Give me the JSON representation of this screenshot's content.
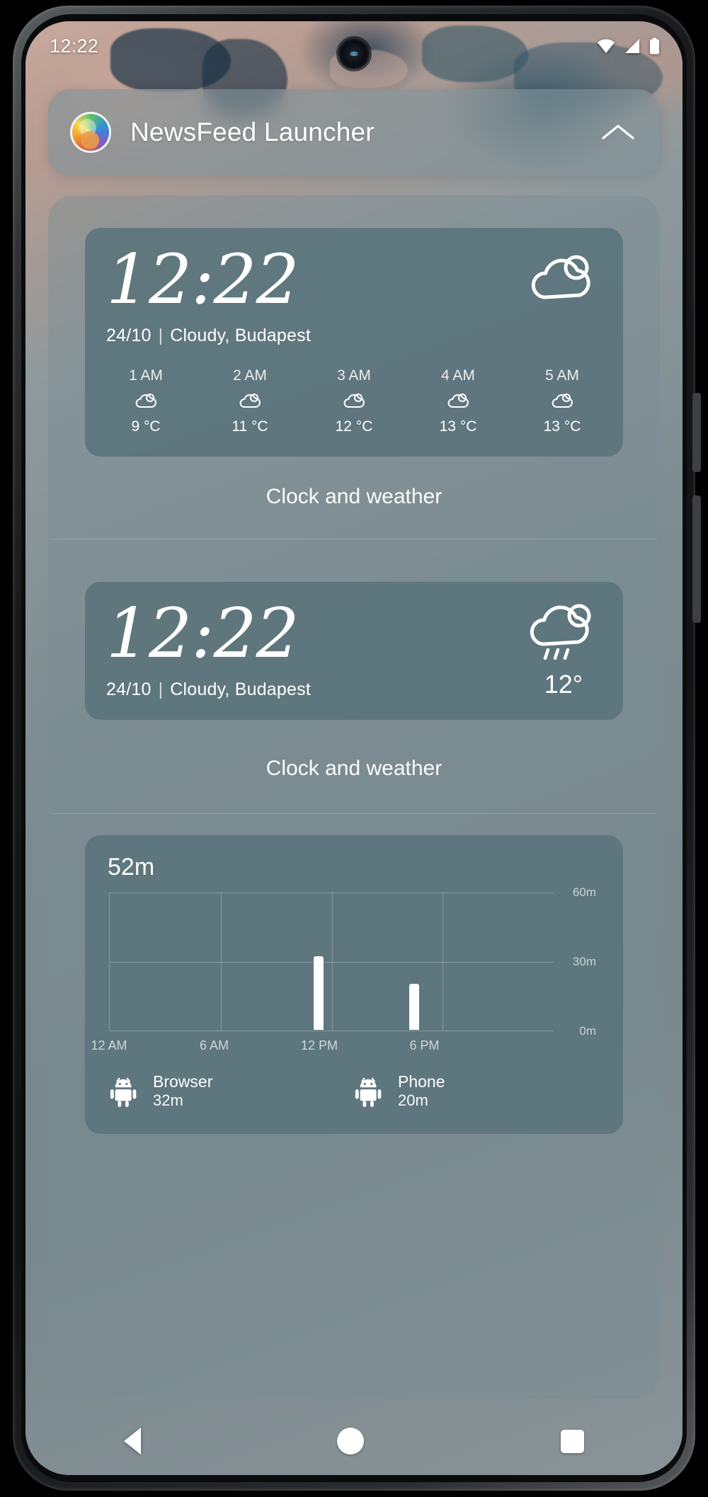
{
  "status_bar": {
    "clock": "12:22",
    "icons": [
      "wifi-icon",
      "signal-icon",
      "battery-icon"
    ]
  },
  "header": {
    "app_icon": "newsfeed-launcher-logo",
    "title": "NewsFeed Launcher",
    "collapse_icon": "chevron-up-icon"
  },
  "widgets": [
    {
      "type": "clock-weather-large",
      "clock": "12:22",
      "date": "24/10",
      "separator": "|",
      "condition_location": "Cloudy, Budapest",
      "weather_icon": "partly-cloudy-icon",
      "label": "Clock and weather",
      "forecast": [
        {
          "hour": "1 AM",
          "icon": "partly-cloudy-icon",
          "temp": "9 °C"
        },
        {
          "hour": "2 AM",
          "icon": "partly-cloudy-icon",
          "temp": "11 °C"
        },
        {
          "hour": "3 AM",
          "icon": "partly-cloudy-icon",
          "temp": "12 °C"
        },
        {
          "hour": "4 AM",
          "icon": "partly-cloudy-icon",
          "temp": "13 °C"
        },
        {
          "hour": "5 AM",
          "icon": "partly-cloudy-icon",
          "temp": "13 °C"
        }
      ]
    },
    {
      "type": "clock-weather-compact",
      "clock": "12:22",
      "date": "24/10",
      "separator": "|",
      "condition_location": "Cloudy, Budapest",
      "weather_icon": "rain-cloud-sun-icon",
      "temperature": "12°",
      "label": "Clock and weather"
    }
  ],
  "wellbeing": {
    "total_time": "52m",
    "apps": [
      {
        "icon": "android-robot-icon",
        "name": "Browser",
        "time": "32m"
      },
      {
        "icon": "android-robot-icon",
        "name": "Phone",
        "time": "20m"
      }
    ]
  },
  "chart_data": {
    "type": "bar",
    "title": "52m",
    "xlabel": "",
    "ylabel": "",
    "categories": [
      "12 AM",
      "6 AM",
      "12 PM",
      "6 PM"
    ],
    "x_tick_positions": [
      0,
      25,
      50,
      75
    ],
    "y_ticks": [
      "0m",
      "30m",
      "60m"
    ],
    "ylim": [
      0,
      60
    ],
    "grid": true,
    "legend": "none",
    "bars": [
      {
        "x_percent": 46.0,
        "value": 32,
        "label": "Browser 32m"
      },
      {
        "x_percent": 67.5,
        "value": 20,
        "label": "Phone 20m"
      }
    ]
  },
  "nav_bar": {
    "back": "back-triangle-icon",
    "home": "home-circle-icon",
    "recents": "recents-square-icon"
  },
  "colors": {
    "card": "#5c747c",
    "panel": "rgba(122,140,147,0.42)",
    "header": "rgba(128,146,152,0.62)",
    "text": "#ffffff"
  }
}
